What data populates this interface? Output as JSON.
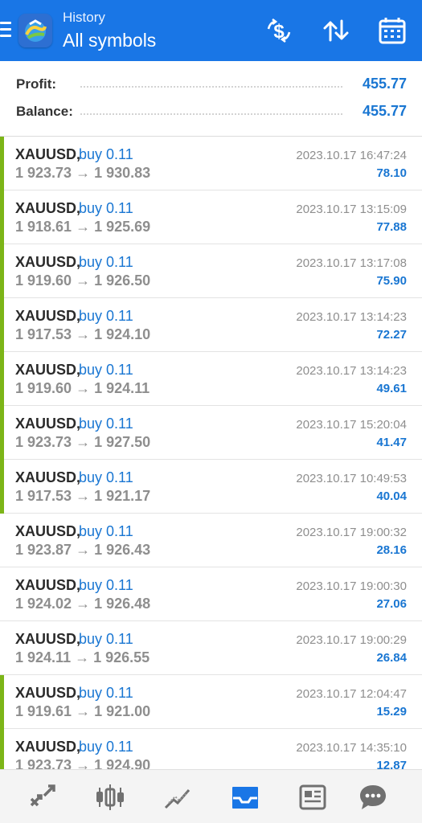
{
  "header": {
    "subtitle": "History",
    "title": "All symbols"
  },
  "summary": {
    "profit_label": "Profit:",
    "profit_value": "455.77",
    "balance_label": "Balance:",
    "balance_value": "455.77"
  },
  "colors": {
    "accent": "#1976e6",
    "link_blue": "#1976d2",
    "profit_bar_green": "#7cb518",
    "muted_gray": "#8e8e8e"
  },
  "trades": [
    {
      "symbol": "XAUUSD,",
      "side": "buy 0.11",
      "prices": "1 923.73 → 1 930.83",
      "time": "2023.10.17 16:47:24",
      "profit": "78.10",
      "bar": true
    },
    {
      "symbol": "XAUUSD,",
      "side": "buy 0.11",
      "prices": "1 918.61 → 1 925.69",
      "time": "2023.10.17 13:15:09",
      "profit": "77.88",
      "bar": true
    },
    {
      "symbol": "XAUUSD,",
      "side": "buy 0.11",
      "prices": "1 919.60 → 1 926.50",
      "time": "2023.10.17 13:17:08",
      "profit": "75.90",
      "bar": true
    },
    {
      "symbol": "XAUUSD,",
      "side": "buy 0.11",
      "prices": "1 917.53 → 1 924.10",
      "time": "2023.10.17 13:14:23",
      "profit": "72.27",
      "bar": true
    },
    {
      "symbol": "XAUUSD,",
      "side": "buy 0.11",
      "prices": "1 919.60 → 1 924.11",
      "time": "2023.10.17 13:14:23",
      "profit": "49.61",
      "bar": true
    },
    {
      "symbol": "XAUUSD,",
      "side": "buy 0.11",
      "prices": "1 923.73 → 1 927.50",
      "time": "2023.10.17 15:20:04",
      "profit": "41.47",
      "bar": true
    },
    {
      "symbol": "XAUUSD,",
      "side": "buy 0.11",
      "prices": "1 917.53 → 1 921.17",
      "time": "2023.10.17 10:49:53",
      "profit": "40.04",
      "bar": true
    },
    {
      "symbol": "XAUUSD,",
      "side": "buy 0.11",
      "prices": "1 923.87 → 1 926.43",
      "time": "2023.10.17 19:00:32",
      "profit": "28.16",
      "bar": false
    },
    {
      "symbol": "XAUUSD,",
      "side": "buy 0.11",
      "prices": "1 924.02 → 1 926.48",
      "time": "2023.10.17 19:00:30",
      "profit": "27.06",
      "bar": false
    },
    {
      "symbol": "XAUUSD,",
      "side": "buy 0.11",
      "prices": "1 924.11 → 1 926.55",
      "time": "2023.10.17 19:00:29",
      "profit": "26.84",
      "bar": false
    },
    {
      "symbol": "XAUUSD,",
      "side": "buy 0.11",
      "prices": "1 919.61 → 1 921.00",
      "time": "2023.10.17 12:04:47",
      "profit": "15.29",
      "bar": true
    },
    {
      "symbol": "XAUUSD,",
      "side": "buy 0.11",
      "prices": "1 923.73 → 1 924.90",
      "time": "2023.10.17 14:35:10",
      "profit": "12.87",
      "bar": true
    }
  ],
  "icons": {
    "menu": "menu-icon",
    "logo": "metatrader-logo",
    "deposit": "dollar-sync-icon",
    "sort": "sort-arrows-icon",
    "calendar": "calendar-icon",
    "nav_quotes": "quotes-icon",
    "nav_chart": "candlestick-chart-icon",
    "nav_trade": "trade-icon",
    "nav_history": "history-inbox-icon",
    "nav_news": "news-icon",
    "nav_chat": "chat-icon"
  }
}
